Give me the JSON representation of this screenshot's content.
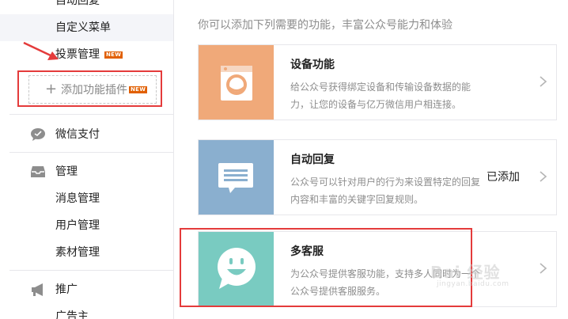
{
  "sidebar": {
    "cut_item": "自动回复",
    "custom_menu": "自定义菜单",
    "vote_manage": "投票管理",
    "new_badge": "NEW",
    "add_plugin": "添加功能插件",
    "add_plugin_badge": "NEW",
    "wechat_pay": "微信支付",
    "manage": {
      "label": "管理",
      "items": [
        "消息管理",
        "用户管理",
        "素材管理"
      ]
    },
    "promote": {
      "label": "推广",
      "items": [
        "广告主"
      ]
    }
  },
  "main": {
    "intro": "你可以添加下列需要的功能，丰富公众号能力和体验",
    "cards": [
      {
        "title": "设备功能",
        "desc": "给公众号获得绑定设备和传输设备数据的能力，让您的设备与亿万微信用户相连接。",
        "status": "",
        "icon": "washing-machine-icon",
        "color": "#f0a979"
      },
      {
        "title": "自动回复",
        "desc": "公众号可以针对用户的行为来设置特定的回复内容和丰富的关键字回复规则。",
        "status": "已添加",
        "icon": "message-icon",
        "color": "#8aafcf"
      },
      {
        "title": "多客服",
        "desc": "为公众号提供客服功能，支持多人同时为一个公众号提供客服服务。",
        "status": "",
        "icon": "smiley-icon",
        "color": "#79cbc1"
      }
    ]
  },
  "watermark": {
    "brand": "Bai 经验",
    "url": "jingyan.baidu.com"
  },
  "colors": {
    "annotation_red": "#e43b3b",
    "new_badge": "#e15f00"
  }
}
